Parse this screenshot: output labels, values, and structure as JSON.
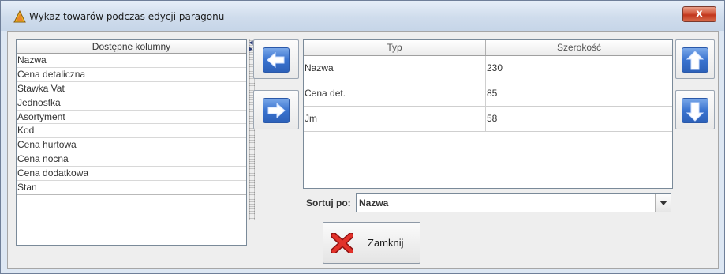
{
  "window": {
    "title": "Wykaz towarów podczas edycji paragonu",
    "close_label": "x"
  },
  "available_columns": {
    "header": "Dostępne kolumny",
    "items": [
      "Nazwa",
      "Cena detaliczna",
      "Stawka Vat",
      "Jednostka",
      "Asortyment",
      "Kod",
      "Cena hurtowa",
      "Cena nocna",
      "Cena dodatkowa",
      "Stan"
    ]
  },
  "selected_columns": {
    "headers": [
      "Typ",
      "Szerokość"
    ],
    "rows": [
      {
        "typ": "Nazwa",
        "szerokosc": "230"
      },
      {
        "typ": "Cena det.",
        "szerokosc": "85"
      },
      {
        "typ": "Jm",
        "szerokosc": "58"
      }
    ]
  },
  "sort": {
    "label": "Sortuj po:",
    "value": "Nazwa"
  },
  "close_button": {
    "label": "Zamknij"
  },
  "icons": {
    "app": "warning-icon",
    "move_left": "arrow-left-icon",
    "move_right": "arrow-right-icon",
    "move_up": "arrow-up-icon",
    "move_down": "arrow-down-icon",
    "close": "red-x-icon"
  },
  "colors": {
    "arrow_blue": "#3a73cf",
    "close_red": "#d2563a"
  }
}
